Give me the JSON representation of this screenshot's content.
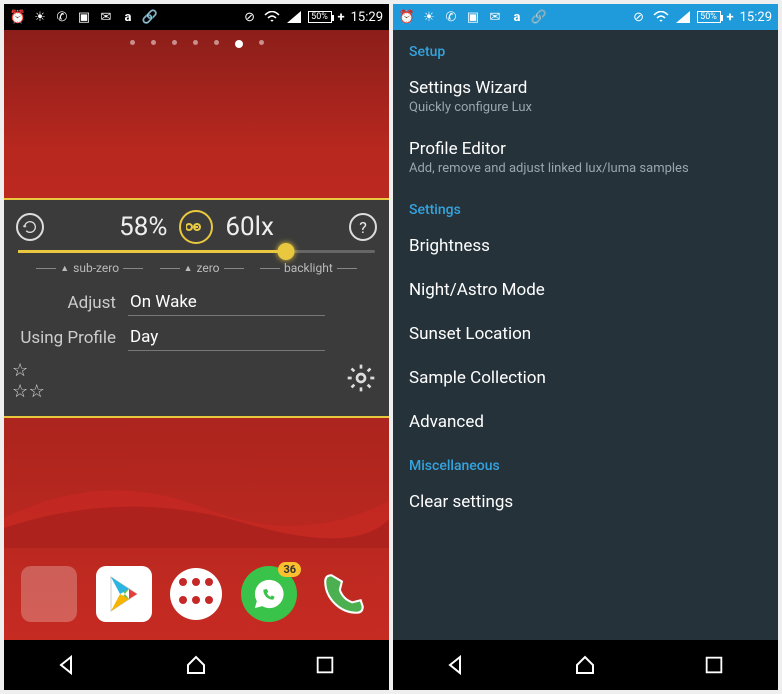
{
  "status": {
    "time": "15:29",
    "battery_pct": "50%",
    "icons": [
      "alarm",
      "brightness",
      "whatsapp",
      "screenshot",
      "mail",
      "amazon",
      "link",
      "blocked",
      "wifi",
      "signal"
    ]
  },
  "left": {
    "pager_active_index": 5,
    "pager_count": 7,
    "panel": {
      "brightness_pct": "58%",
      "lux_value": "60lx",
      "slider_labels": {
        "subzero": "sub-zero",
        "zero": "zero",
        "backlight": "backlight"
      },
      "adjust_label": "Adjust",
      "adjust_value": "On Wake",
      "profile_label": "Using Profile",
      "profile_value": "Day"
    },
    "dock": {
      "whatsapp_badge": "36"
    }
  },
  "right": {
    "sections": {
      "setup": {
        "header": "Setup",
        "items": [
          {
            "title": "Settings Wizard",
            "sub": "Quickly configure Lux"
          },
          {
            "title": "Profile Editor",
            "sub": "Add, remove and adjust linked lux/luma samples"
          }
        ]
      },
      "settings": {
        "header": "Settings",
        "items": [
          {
            "title": "Brightness"
          },
          {
            "title": "Night/Astro Mode"
          },
          {
            "title": "Sunset Location"
          },
          {
            "title": "Sample Collection"
          },
          {
            "title": "Advanced"
          }
        ]
      },
      "misc": {
        "header": "Miscellaneous",
        "items": [
          {
            "title": "Clear settings"
          }
        ]
      }
    }
  }
}
